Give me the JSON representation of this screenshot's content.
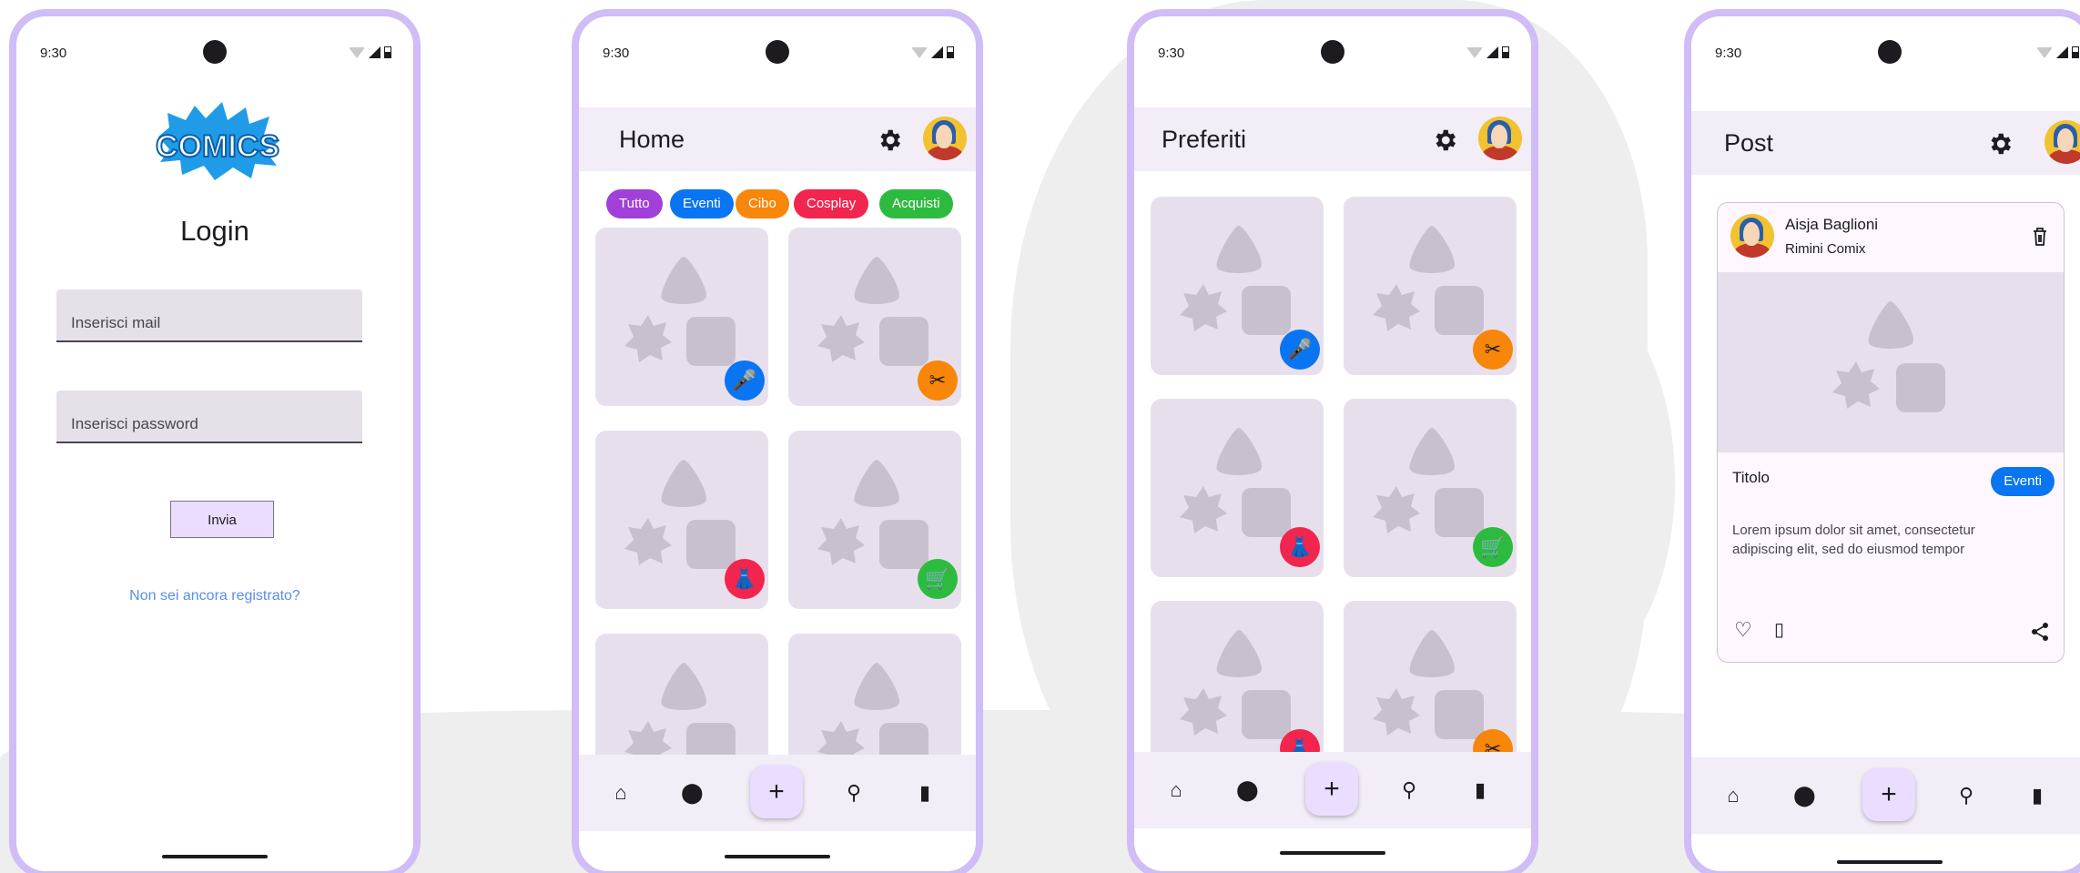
{
  "status_time": "9:30",
  "login": {
    "logo_text": "COMICS",
    "title": "Login",
    "email_placeholder": "Inserisci mail",
    "password_placeholder": "Inserisci password",
    "submit_label": "Invia",
    "register_link": "Non sei ancora registrato?"
  },
  "home": {
    "title": "Home",
    "filters": [
      {
        "label": "Tutto",
        "color": "#a040d8"
      },
      {
        "label": "Eventi",
        "color": "#0a75f2"
      },
      {
        "label": "Cibo",
        "color": "#f7860a"
      },
      {
        "label": "Cosplay",
        "color": "#f2254f"
      },
      {
        "label": "Acquisti",
        "color": "#2dbb3f"
      }
    ],
    "cards": [
      {
        "category": "microphone-icon",
        "color": "#0a75f2"
      },
      {
        "category": "utensils-icon",
        "color": "#f7860a"
      },
      {
        "category": "dress-icon",
        "color": "#f2254f"
      },
      {
        "category": "cart-icon",
        "color": "#2dbb3f"
      },
      {
        "category": "none",
        "color": ""
      },
      {
        "category": "none",
        "color": ""
      }
    ]
  },
  "favorites": {
    "title": "Preferiti",
    "cards": [
      {
        "category": "microphone-icon",
        "color": "#0a75f2"
      },
      {
        "category": "utensils-icon",
        "color": "#f7860a"
      },
      {
        "category": "dress-icon",
        "color": "#f2254f"
      },
      {
        "category": "cart-icon",
        "color": "#2dbb3f"
      },
      {
        "category": "dress-icon",
        "color": "#f2254f"
      },
      {
        "category": "utensils-icon",
        "color": "#f7860a"
      }
    ]
  },
  "post": {
    "title": "Post",
    "author": "Aisja Baglioni",
    "event": "Rimini Comix",
    "post_title": "Titolo",
    "tag": "Eventi",
    "tag_color": "#0a75f2",
    "body": "Lorem ipsum dolor sit amet, consectetur adipiscing elit, sed do eiusmod tempor"
  },
  "nav": {
    "items": [
      "home-icon",
      "location-pin-icon",
      "add-icon",
      "search-icon",
      "bookmark-icon"
    ],
    "fab_label": "+"
  },
  "colors": {
    "phone_frame": "#d0bcf7",
    "surface": "#f3edf7",
    "fab": "#eaddff",
    "placeholder": "#e7e0ec",
    "link": "#5a8ee6"
  }
}
